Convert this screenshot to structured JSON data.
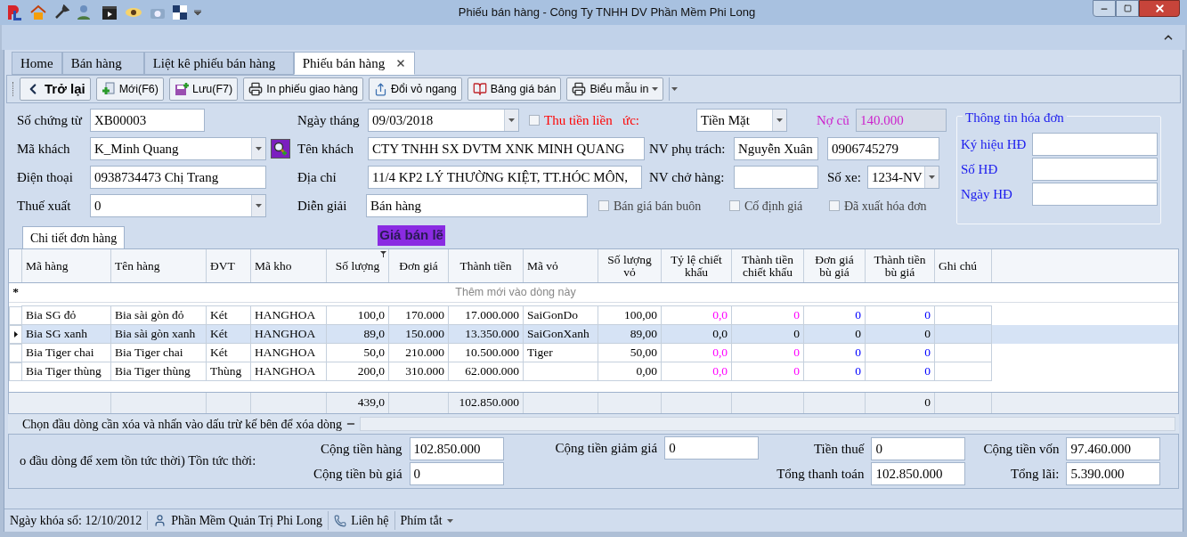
{
  "window": {
    "title": "Phiếu bán hàng - Công Ty TNHH DV Phần Mềm Phi Long"
  },
  "tabs": [
    {
      "label": "Home",
      "selected": false,
      "closable": false
    },
    {
      "label": "Bán hàng",
      "selected": false,
      "closable": false
    },
    {
      "label": "Liệt kê phiếu bán hàng",
      "selected": false,
      "closable": false
    },
    {
      "label": "Phiếu bán hàng",
      "selected": true,
      "closable": true
    }
  ],
  "toolbar": [
    {
      "label": "Trở lại",
      "kind": "back"
    },
    {
      "label": "Mới(F6)",
      "kind": "new"
    },
    {
      "label": "Lưu(F7)",
      "kind": "save"
    },
    {
      "label": "In phiếu giao hàng",
      "kind": "print"
    },
    {
      "label": "Đổi vỏ ngang",
      "kind": "swap"
    },
    {
      "label": "Bảng giá bán",
      "kind": "price"
    },
    {
      "label": "Biểu mẫu in",
      "kind": "print-menu"
    }
  ],
  "form": {
    "voucher_no": {
      "label": "Số chứng từ",
      "value": "XB00003"
    },
    "date": {
      "label": "Ngày tháng",
      "value": "09/03/2018"
    },
    "collect_now": {
      "label": "Thu tiền liền",
      "checked": false
    },
    "payment": {
      "label": "ức:",
      "value": "Tiền Mặt"
    },
    "old_debt": {
      "label": "Nợ cũ",
      "value": "140.000"
    },
    "customer_code": {
      "label": "Mã khách",
      "value": "K_Minh Quang"
    },
    "customer_name": {
      "label": "Tên khách",
      "value": "CTY TNHH SX DVTM XNK MINH QUANG"
    },
    "staff": {
      "label": "NV phụ trách:",
      "value": "Nguyễn Xuân",
      "phone": "0906745279"
    },
    "phone": {
      "label": "Điện thoại",
      "value": "0938734473 Chị Trang"
    },
    "address": {
      "label": "Địa chỉ",
      "value": "11/4 KP2 LÝ THƯỜNG KIỆT, TT.HÓC MÔN,"
    },
    "shipper": {
      "label": "NV chở hàng:"
    },
    "plate": {
      "label": "Số xe:",
      "value": "1234-NV"
    },
    "tax": {
      "label": "Thuế xuất",
      "value": "0"
    },
    "description": {
      "label": "Diễn giải",
      "value": "Bán hàng"
    },
    "options": [
      {
        "label": "Bán giá bán buôn",
        "checked": false
      },
      {
        "label": "Cố định giá",
        "checked": false
      },
      {
        "label": "Đã xuất hóa đơn",
        "checked": false
      }
    ]
  },
  "invoice": {
    "title": "Thông tin hóa đơn",
    "fields": [
      {
        "label": "Ký hiệu HĐ"
      },
      {
        "label": "Số HĐ"
      },
      {
        "label": "Ngày HĐ"
      }
    ]
  },
  "grid": {
    "tab": "Chi tiết đơn hàng",
    "price_mode": "Giá bán lẽ",
    "new_row": {
      "marker": "*",
      "placeholder": "Thêm mới vào dòng này"
    },
    "columns": [
      {
        "label": "Mã hàng",
        "kind": "text",
        "filtered": false
      },
      {
        "label": "Tên hàng",
        "kind": "text",
        "filtered": false
      },
      {
        "label": "ĐVT",
        "kind": "text",
        "filtered": false
      },
      {
        "label": "Mã kho",
        "kind": "text",
        "filtered": false
      },
      {
        "label": "Số lượng",
        "kind": "number",
        "filtered": true,
        "total": "439,0"
      },
      {
        "label": "Đơn giá",
        "kind": "number",
        "filtered": false
      },
      {
        "label": "Thành tiền",
        "kind": "number",
        "filtered": false,
        "total": "102.850.000"
      },
      {
        "label": "Mã vỏ",
        "kind": "text",
        "filtered": false
      },
      {
        "label": "Số lượng vỏ",
        "kind": "number",
        "filtered": false
      },
      {
        "label": "Tỷ lệ chiết khấu",
        "kind": "number",
        "filtered": false,
        "color": "#ff00ff"
      },
      {
        "label": "Thành tiền chiết khấu",
        "kind": "number",
        "filtered": false,
        "color": "#ff00ff"
      },
      {
        "label": "Đơn giá bù giá",
        "kind": "number",
        "filtered": false,
        "color": "#0000ff"
      },
      {
        "label": "Thành tiền bù giá",
        "kind": "number",
        "filtered": false,
        "color": "#0000ff",
        "total": "0"
      },
      {
        "label": "Ghi chú",
        "kind": "text",
        "filtered": false
      }
    ],
    "rows": [
      {
        "selected": false,
        "cells": [
          "Bia SG đỏ",
          "Bia sài gòn đỏ",
          "Két",
          "HANGHOA",
          "100,0",
          "170.000",
          "17.000.000",
          "SaiGonDo",
          "100,00",
          "0,0",
          "0",
          "0",
          "0",
          null
        ]
      },
      {
        "selected": true,
        "cells": [
          "Bia SG xanh",
          "Bia sài gòn xanh",
          "Két",
          "HANGHOA",
          "89,0",
          "150.000",
          "13.350.000",
          "SaiGonXanh",
          "89,00",
          "0,0",
          "0",
          "0",
          "0",
          null
        ]
      },
      {
        "selected": false,
        "cells": [
          "Bia Tiger chai",
          "Bia Tiger chai",
          "Két",
          "HANGHOA",
          "50,0",
          "210.000",
          "10.500.000",
          "Tiger",
          "50,00",
          "0,0",
          "0",
          "0",
          "0",
          null
        ]
      },
      {
        "selected": false,
        "cells": [
          "Bia Tiger thùng",
          "Bia Tiger thùng",
          "Thùng",
          "HANGHOA",
          "200,0",
          "310.000",
          "62.000.000",
          null,
          "0,00",
          "0,0",
          "0",
          "0",
          "0",
          null
        ]
      }
    ],
    "hint": "Chọn đầu dòng cần xóa và nhấn vào dấu trừ kế bên để xóa dòng"
  },
  "totals": {
    "stock_hint": "o đầu dòng để xem tồn tức thời) Tồn tức thời:",
    "groups": [
      [
        {
          "label": "Cộng tiền hàng",
          "value": "102.850.000"
        },
        {
          "label": "Cộng tiền bù giá",
          "value": "0"
        }
      ],
      [
        {
          "label": "Cộng tiền giảm giá",
          "value": "0"
        }
      ],
      [
        {
          "label": "Tiền thuế",
          "value": "0"
        },
        {
          "label": "Tổng thanh toán",
          "value": "102.850.000"
        }
      ],
      [
        {
          "label": "Cộng tiền vốn",
          "value": "97.460.000"
        },
        {
          "label": "Tổng lãi:",
          "value": "5.390.000"
        }
      ]
    ]
  },
  "status_bar": [
    {
      "label": "Ngày khóa sổ: 12/10/2012",
      "kind": "text"
    },
    {
      "label": "Phần Mềm Quản Trị Phi Long",
      "kind": "person"
    },
    {
      "label": "Liên hệ",
      "kind": "phone"
    },
    {
      "label": "Phím tắt",
      "kind": "menu"
    }
  ]
}
